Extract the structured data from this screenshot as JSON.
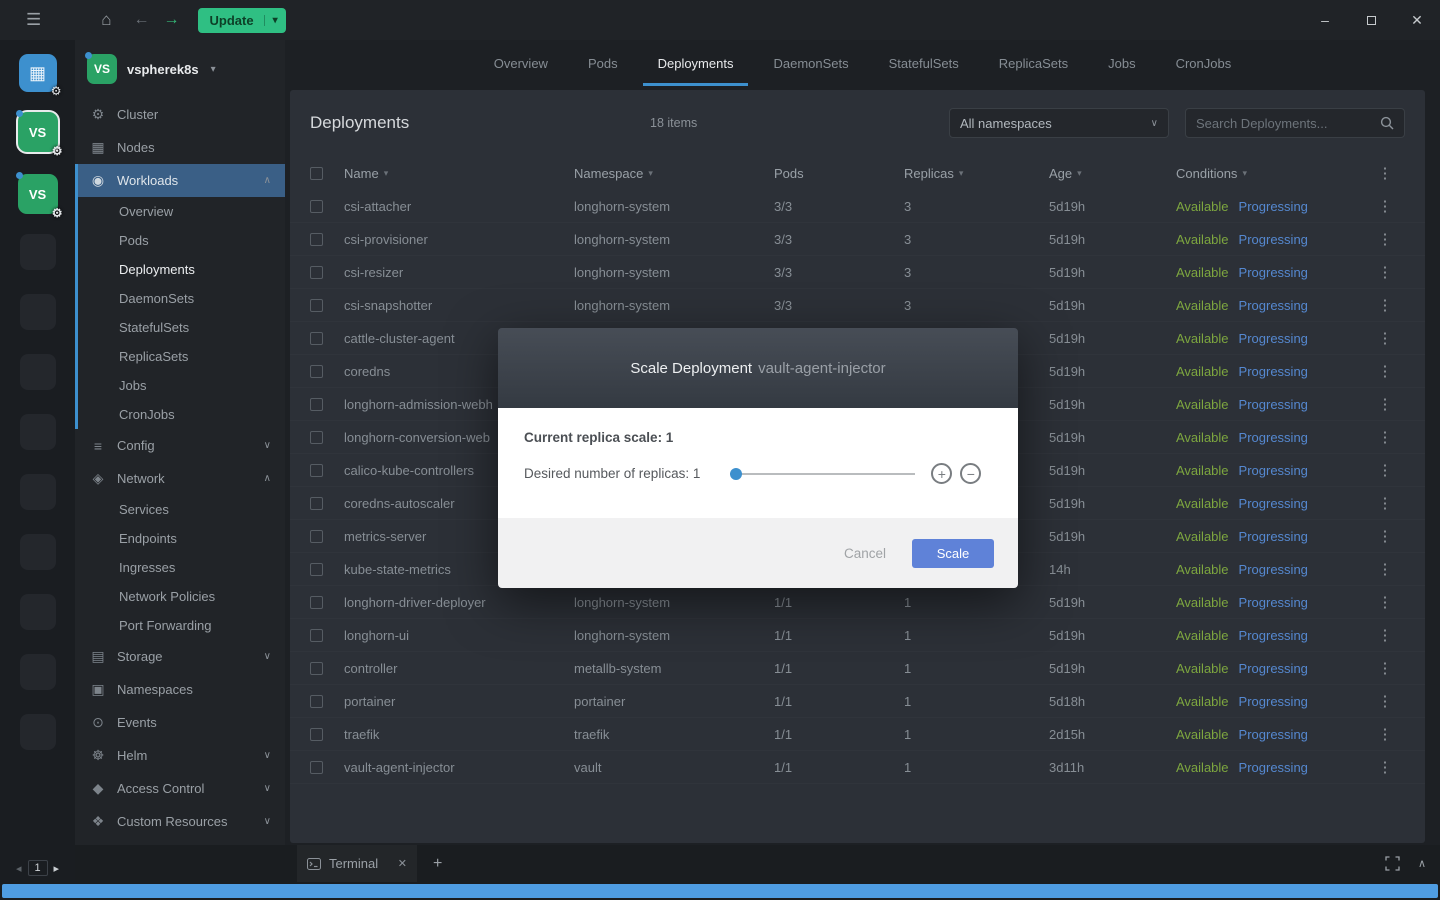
{
  "colors": {
    "accent_blue": "#3d90ce",
    "update_green": "#2fbf83",
    "available_green": "#7da63f",
    "progressing_blue": "#5588d0",
    "scale_button_blue": "#5f82d8",
    "scrollbar_blue": "#4f9de2",
    "cluster_green": "#2aa265",
    "workloads_highlight": "#3a5f86"
  },
  "icons": {
    "menu": "☰",
    "home": "⌂",
    "back": "←",
    "forward": "→",
    "caret_down": "▾",
    "chevron_down": "∨",
    "chevron_up": "∧",
    "kebab": "⋮",
    "plus": "+",
    "minus": "−",
    "close": "✕",
    "minimize": "–",
    "dashboard_grid": "▦",
    "page_prev": "◂",
    "page_next": "▸",
    "gear": "⚙"
  },
  "titlebar": {
    "update_label": "Update"
  },
  "rail": {
    "clusters": [
      {
        "initials": "VS",
        "active": true
      },
      {
        "initials": "VS",
        "active": false
      }
    ],
    "placeholder_count": 9,
    "page": "1"
  },
  "sidebar": {
    "cluster_initials": "VS",
    "cluster_name": "vspherek8s",
    "items": [
      {
        "label": "Cluster",
        "icon": "cluster-icon",
        "glyph": "⚙"
      },
      {
        "label": "Nodes",
        "icon": "nodes-icon",
        "glyph": "▦"
      },
      {
        "label": "Workloads",
        "icon": "workloads-icon",
        "glyph": "◉",
        "expanded": true,
        "active": true,
        "accent": true
      },
      {
        "label": "Overview",
        "sub": true,
        "accent": true
      },
      {
        "label": "Pods",
        "sub": true,
        "accent": true
      },
      {
        "label": "Deployments",
        "sub": true,
        "accent": true,
        "current": true
      },
      {
        "label": "DaemonSets",
        "sub": true,
        "accent": true
      },
      {
        "label": "StatefulSets",
        "sub": true,
        "accent": true
      },
      {
        "label": "ReplicaSets",
        "sub": true,
        "accent": true
      },
      {
        "label": "Jobs",
        "sub": true,
        "accent": true
      },
      {
        "label": "CronJobs",
        "sub": true,
        "accent": true
      },
      {
        "label": "Config",
        "icon": "config-icon",
        "glyph": "≡",
        "expanded": false
      },
      {
        "label": "Network",
        "icon": "network-icon",
        "glyph": "◈",
        "expanded": true
      },
      {
        "label": "Services",
        "sub": true
      },
      {
        "label": "Endpoints",
        "sub": true
      },
      {
        "label": "Ingresses",
        "sub": true
      },
      {
        "label": "Network Policies",
        "sub": true
      },
      {
        "label": "Port Forwarding",
        "sub": true
      },
      {
        "label": "Storage",
        "icon": "storage-icon",
        "glyph": "▤",
        "expanded": false
      },
      {
        "label": "Namespaces",
        "icon": "namespaces-icon",
        "glyph": "▣"
      },
      {
        "label": "Events",
        "icon": "events-icon",
        "glyph": "⊙"
      },
      {
        "label": "Helm",
        "icon": "helm-icon",
        "glyph": "☸",
        "expanded": false
      },
      {
        "label": "Access Control",
        "icon": "access-control-icon",
        "glyph": "◆",
        "expanded": false
      },
      {
        "label": "Custom Resources",
        "icon": "custom-resources-icon",
        "glyph": "❖",
        "expanded": false
      }
    ]
  },
  "tabs": {
    "items": [
      "Overview",
      "Pods",
      "Deployments",
      "DaemonSets",
      "StatefulSets",
      "ReplicaSets",
      "Jobs",
      "CronJobs"
    ],
    "active": "Deployments"
  },
  "header": {
    "title": "Deployments",
    "count": "18 items",
    "namespace_filter": "All namespaces",
    "search_placeholder": "Search Deployments..."
  },
  "table": {
    "columns": [
      {
        "label": "Name",
        "sortable": true
      },
      {
        "label": "Namespace",
        "sortable": true
      },
      {
        "label": "Pods",
        "sortable": false
      },
      {
        "label": "Replicas",
        "sortable": true
      },
      {
        "label": "Age",
        "sortable": true
      },
      {
        "label": "Conditions",
        "sortable": true
      }
    ],
    "rows": [
      {
        "name": "csi-attacher",
        "namespace": "longhorn-system",
        "pods": "3/3",
        "replicas": "3",
        "age": "5d19h",
        "conditions": [
          "Available",
          "Progressing"
        ]
      },
      {
        "name": "csi-provisioner",
        "namespace": "longhorn-system",
        "pods": "3/3",
        "replicas": "3",
        "age": "5d19h",
        "conditions": [
          "Available",
          "Progressing"
        ]
      },
      {
        "name": "csi-resizer",
        "namespace": "longhorn-system",
        "pods": "3/3",
        "replicas": "3",
        "age": "5d19h",
        "conditions": [
          "Available",
          "Progressing"
        ]
      },
      {
        "name": "csi-snapshotter",
        "namespace": "longhorn-system",
        "pods": "3/3",
        "replicas": "3",
        "age": "5d19h",
        "conditions": [
          "Available",
          "Progressing"
        ]
      },
      {
        "name": "cattle-cluster-agent",
        "namespace": "",
        "pods": "",
        "replicas": "",
        "age": "5d19h",
        "conditions": [
          "Available",
          "Progressing"
        ]
      },
      {
        "name": "coredns",
        "namespace": "",
        "pods": "",
        "replicas": "",
        "age": "5d19h",
        "conditions": [
          "Available",
          "Progressing"
        ]
      },
      {
        "name": "longhorn-admission-webh",
        "namespace": "",
        "pods": "",
        "replicas": "",
        "age": "5d19h",
        "conditions": [
          "Available",
          "Progressing"
        ]
      },
      {
        "name": "longhorn-conversion-web",
        "namespace": "",
        "pods": "",
        "replicas": "",
        "age": "5d19h",
        "conditions": [
          "Available",
          "Progressing"
        ]
      },
      {
        "name": "calico-kube-controllers",
        "namespace": "",
        "pods": "",
        "replicas": "",
        "age": "5d19h",
        "conditions": [
          "Available",
          "Progressing"
        ]
      },
      {
        "name": "coredns-autoscaler",
        "namespace": "",
        "pods": "",
        "replicas": "",
        "age": "5d19h",
        "conditions": [
          "Available",
          "Progressing"
        ]
      },
      {
        "name": "metrics-server",
        "namespace": "",
        "pods": "",
        "replicas": "",
        "age": "5d19h",
        "conditions": [
          "Available",
          "Progressing"
        ]
      },
      {
        "name": "kube-state-metrics",
        "namespace": "",
        "pods": "",
        "replicas": "",
        "age": "14h",
        "conditions": [
          "Available",
          "Progressing"
        ]
      },
      {
        "name": "longhorn-driver-deployer",
        "namespace": "longhorn-system",
        "pods": "1/1",
        "replicas": "1",
        "age": "5d19h",
        "conditions": [
          "Available",
          "Progressing"
        ]
      },
      {
        "name": "longhorn-ui",
        "namespace": "longhorn-system",
        "pods": "1/1",
        "replicas": "1",
        "age": "5d19h",
        "conditions": [
          "Available",
          "Progressing"
        ]
      },
      {
        "name": "controller",
        "namespace": "metallb-system",
        "pods": "1/1",
        "replicas": "1",
        "age": "5d19h",
        "conditions": [
          "Available",
          "Progressing"
        ]
      },
      {
        "name": "portainer",
        "namespace": "portainer",
        "pods": "1/1",
        "replicas": "1",
        "age": "5d18h",
        "conditions": [
          "Available",
          "Progressing"
        ]
      },
      {
        "name": "traefik",
        "namespace": "traefik",
        "pods": "1/1",
        "replicas": "1",
        "age": "2d15h",
        "conditions": [
          "Available",
          "Progressing"
        ]
      },
      {
        "name": "vault-agent-injector",
        "namespace": "vault",
        "pods": "1/1",
        "replicas": "1",
        "age": "3d11h",
        "conditions": [
          "Available",
          "Progressing"
        ]
      }
    ]
  },
  "modal": {
    "title": "Scale Deployment",
    "subject": "vault-agent-injector",
    "current_label": "Current replica scale: 1",
    "desired_label": "Desired number of replicas: 1",
    "cancel_label": "Cancel",
    "confirm_label": "Scale"
  },
  "dock": {
    "terminal_label": "Terminal"
  }
}
